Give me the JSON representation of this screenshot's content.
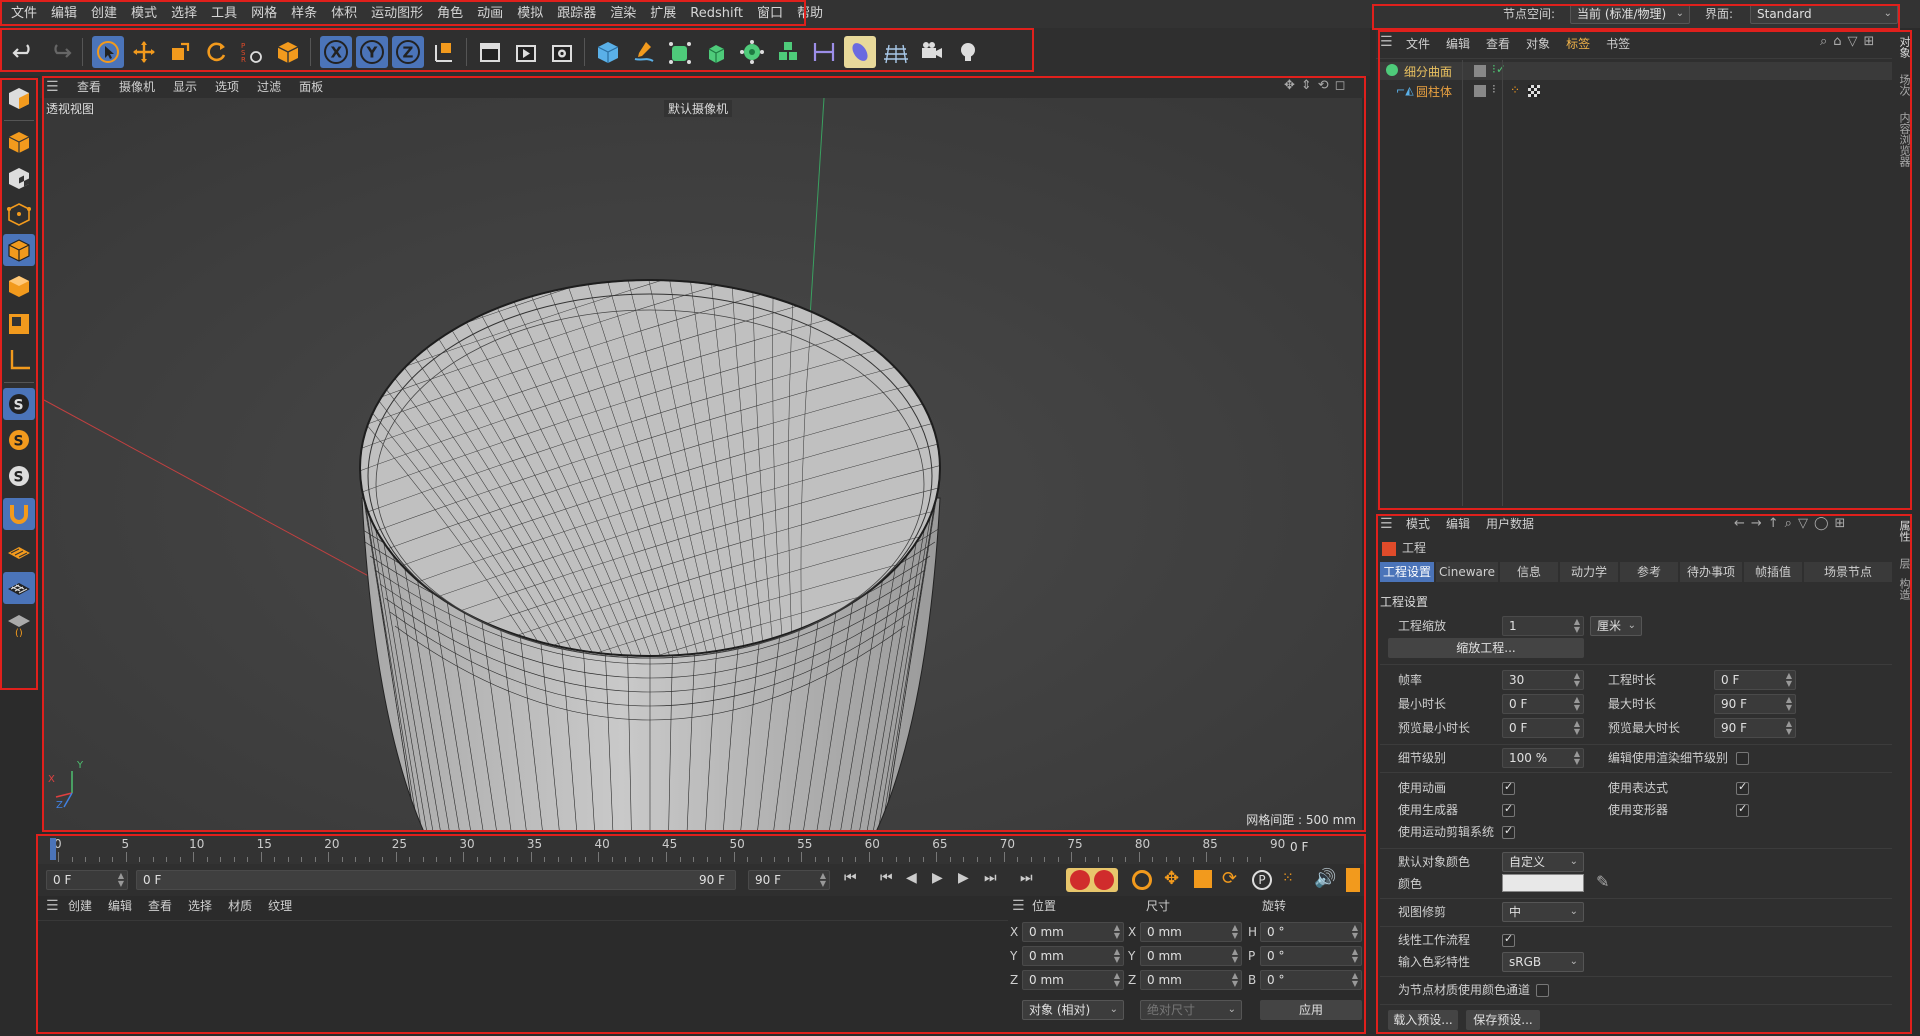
{
  "menubar": {
    "items": [
      "文件",
      "编辑",
      "创建",
      "模式",
      "选择",
      "工具",
      "网格",
      "样条",
      "体积",
      "运动图形",
      "角色",
      "动画",
      "模拟",
      "跟踪器",
      "渲染",
      "扩展",
      "Redshift",
      "窗口",
      "帮助"
    ],
    "node_space_label": "节点空间:",
    "node_space_value": "当前 (标准/物理)",
    "interface_label": "界面:",
    "interface_value": "Standard"
  },
  "viewport": {
    "menu": [
      "查看",
      "摄像机",
      "显示",
      "选项",
      "过滤",
      "面板"
    ],
    "view_name": "透视视图",
    "camera_name": "默认摄像机",
    "grid_spacing": "网格间距 : 500 mm",
    "axis_labels": [
      "X",
      "Y",
      "Z"
    ]
  },
  "timeline": {
    "ticks": [
      "0",
      "5",
      "10",
      "15",
      "20",
      "25",
      "30",
      "35",
      "40",
      "45",
      "50",
      "55",
      "60",
      "65",
      "70",
      "75",
      "80",
      "85",
      "90"
    ],
    "current_frame": "0 F"
  },
  "playbar": {
    "start_field": "0 F",
    "range_start": "0 F",
    "range_end": "90 F",
    "end_field": "90 F"
  },
  "material_panel": {
    "menu": [
      "创建",
      "编辑",
      "查看",
      "选择",
      "材质",
      "纹理"
    ]
  },
  "coord_panel": {
    "headers": [
      "位置",
      "尺寸",
      "旋转"
    ],
    "rows": [
      {
        "pos_axis": "X",
        "pos": "0 mm",
        "size_axis": "X",
        "size": "0 mm",
        "rot_axis": "H",
        "rot": "0 °"
      },
      {
        "pos_axis": "Y",
        "pos": "0 mm",
        "size_axis": "Y",
        "size": "0 mm",
        "rot_axis": "P",
        "rot": "0 °"
      },
      {
        "pos_axis": "Z",
        "pos": "0 mm",
        "size_axis": "Z",
        "size": "0 mm",
        "rot_axis": "B",
        "rot": "0 °"
      }
    ],
    "mode_dropdown": "对象 (相对)",
    "size_dropdown": "绝对尺寸",
    "apply_button": "应用"
  },
  "object_manager": {
    "menu": [
      "文件",
      "编辑",
      "查看",
      "对象",
      "标签",
      "书签"
    ],
    "objects": [
      {
        "name": "细分曲面",
        "color": "#e8c060"
      },
      {
        "name": "圆柱体",
        "color": "#e8a040"
      }
    ],
    "side_tabs": [
      "对象",
      "场次",
      "内容浏览器"
    ]
  },
  "attribute_manager": {
    "menu": [
      "模式",
      "编辑",
      "用户数据"
    ],
    "title": "工程",
    "tabs": [
      "工程设置",
      "Cineware",
      "信息",
      "动力学",
      "参考",
      "待办事项",
      "帧插值",
      "场景节点"
    ],
    "section": "工程设置",
    "project_scale_label": "工程缩放",
    "project_scale_value": "1",
    "project_scale_unit": "厘米",
    "scale_project_button": "缩放工程...",
    "fps_label": "帧率",
    "fps_value": "30",
    "project_time_label": "工程时长",
    "project_time_value": "0 F",
    "min_time_label": "最小时长",
    "min_time_value": "0 F",
    "max_time_label": "最大时长",
    "max_time_value": "90 F",
    "preview_min_label": "预览最小时长",
    "preview_min_value": "0 F",
    "preview_max_label": "预览最大时长",
    "preview_max_value": "90 F",
    "lod_label": "细节级别",
    "lod_value": "100 %",
    "render_lod_label": "编辑使用渲染细节级别",
    "use_anim_label": "使用动画",
    "use_expr_label": "使用表达式",
    "use_gen_label": "使用生成器",
    "use_deform_label": "使用变形器",
    "use_motion_label": "使用运动剪辑系统",
    "default_color_label": "默认对象颜色",
    "default_color_value": "自定义",
    "color_label": "颜色",
    "view_clip_label": "视图修剪",
    "view_clip_value": "中",
    "linear_label": "线性工作流程",
    "input_color_label": "输入色彩特性",
    "input_color_value": "sRGB",
    "node_mat_label": "为节点材质使用颜色通道",
    "load_preset_button": "载入预设...",
    "save_preset_button": "保存预设...",
    "side_tabs": [
      "属性",
      "层",
      "构造"
    ]
  }
}
